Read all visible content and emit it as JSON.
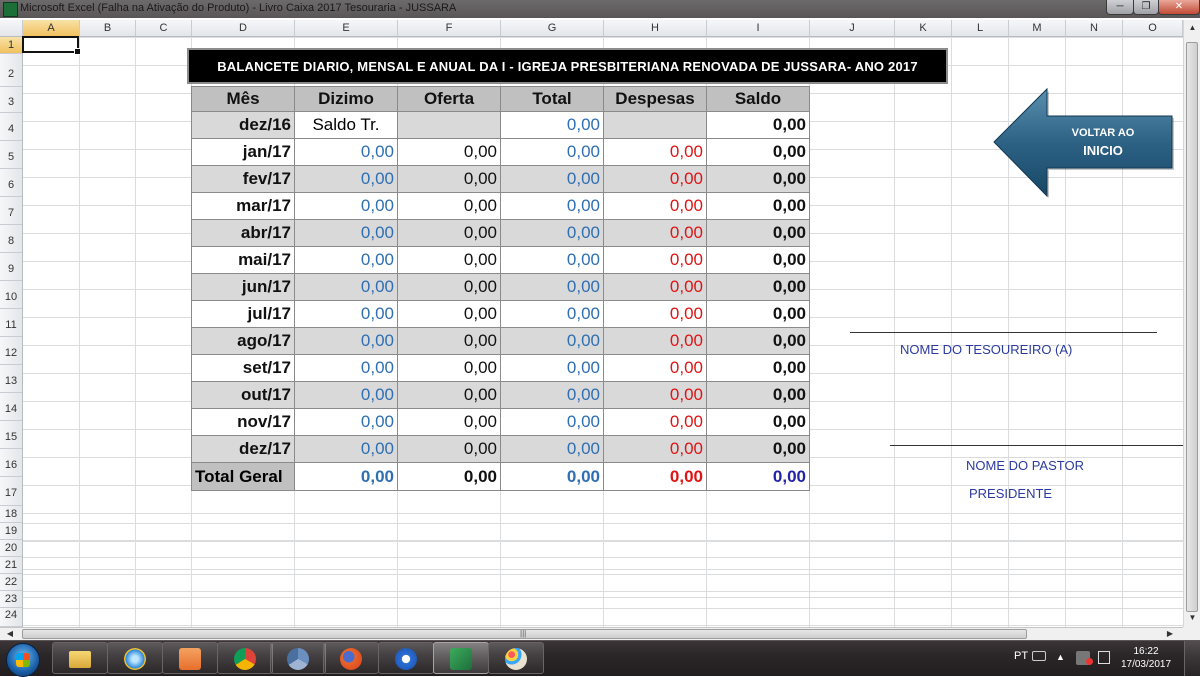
{
  "window": {
    "title": "Microsoft Excel (Falha na Ativação do Produto) - Livro Caixa 2017 Tesouraria - JUSSARA",
    "minimize_glyph": "─",
    "restore_glyph": "❐",
    "close_glyph": "✕"
  },
  "columns": [
    "A",
    "B",
    "C",
    "D",
    "E",
    "F",
    "G",
    "H",
    "I",
    "J",
    "K",
    "L",
    "M",
    "N",
    "O"
  ],
  "rows": [
    "1",
    "2",
    "3",
    "4",
    "5",
    "6",
    "7",
    "8",
    "9",
    "10",
    "11",
    "12",
    "13",
    "14",
    "15",
    "16",
    "17",
    "18",
    "19",
    "20",
    "21",
    "22",
    "23",
    "24"
  ],
  "selected_cell": "A1",
  "banner": "BALANCETE DIARIO, MENSAL E ANUAL DA  I - IGREJA PRESBITERIANA RENOVADA  DE JUSSARA-  ANO 2017",
  "table": {
    "headers": [
      "Mês",
      "Dizimo",
      "Oferta",
      "Total",
      "Despesas",
      "Saldo"
    ],
    "first_row": {
      "month": "dez/16",
      "dizimo": "Saldo Tr.",
      "oferta": "",
      "total": "0,00",
      "despesas": "",
      "saldo": "0,00"
    },
    "rows": [
      {
        "month": "jan/17",
        "dizimo": "0,00",
        "oferta": "0,00",
        "total": "0,00",
        "despesas": "0,00",
        "saldo": "0,00"
      },
      {
        "month": "fev/17",
        "dizimo": "0,00",
        "oferta": "0,00",
        "total": "0,00",
        "despesas": "0,00",
        "saldo": "0,00"
      },
      {
        "month": "mar/17",
        "dizimo": "0,00",
        "oferta": "0,00",
        "total": "0,00",
        "despesas": "0,00",
        "saldo": "0,00"
      },
      {
        "month": "abr/17",
        "dizimo": "0,00",
        "oferta": "0,00",
        "total": "0,00",
        "despesas": "0,00",
        "saldo": "0,00"
      },
      {
        "month": "mai/17",
        "dizimo": "0,00",
        "oferta": "0,00",
        "total": "0,00",
        "despesas": "0,00",
        "saldo": "0,00"
      },
      {
        "month": "jun/17",
        "dizimo": "0,00",
        "oferta": "0,00",
        "total": "0,00",
        "despesas": "0,00",
        "saldo": "0,00"
      },
      {
        "month": "jul/17",
        "dizimo": "0,00",
        "oferta": "0,00",
        "total": "0,00",
        "despesas": "0,00",
        "saldo": "0,00"
      },
      {
        "month": "ago/17",
        "dizimo": "0,00",
        "oferta": "0,00",
        "total": "0,00",
        "despesas": "0,00",
        "saldo": "0,00"
      },
      {
        "month": "set/17",
        "dizimo": "0,00",
        "oferta": "0,00",
        "total": "0,00",
        "despesas": "0,00",
        "saldo": "0,00"
      },
      {
        "month": "out/17",
        "dizimo": "0,00",
        "oferta": "0,00",
        "total": "0,00",
        "despesas": "0,00",
        "saldo": "0,00"
      },
      {
        "month": "nov/17",
        "dizimo": "0,00",
        "oferta": "0,00",
        "total": "0,00",
        "despesas": "0,00",
        "saldo": "0,00"
      },
      {
        "month": "dez/17",
        "dizimo": "0,00",
        "oferta": "0,00",
        "total": "0,00",
        "despesas": "0,00",
        "saldo": "0,00"
      }
    ],
    "total": {
      "label": "Total Geral",
      "dizimo": "0,00",
      "oferta": "0,00",
      "total": "0,00",
      "despesas": "0,00",
      "saldo": "0,00"
    }
  },
  "back_button": {
    "line1": "VOLTAR AO",
    "line2": "INICIO"
  },
  "signatures": {
    "treasurer": "NOME DO TESOUREIRO  (A)",
    "pastor": "NOME DO PASTOR",
    "president": "PRESIDENTE"
  },
  "taskbar": {
    "apps": [
      "explorer-icon",
      "internet-explorer-icon",
      "media-player-icon",
      "chrome-icon",
      "chrome-icon",
      "firefox-icon",
      "shield-icon",
      "excel-icon",
      "paint-icon"
    ],
    "active_app": "excel-icon",
    "language": "PT",
    "time": "16:22",
    "date": "17/03/2017"
  },
  "colors": {
    "blue_value": "#2e6fb3",
    "red_value": "#e01414",
    "header_gray": "#c0c0c0",
    "shade_gray": "#d9d9d9",
    "signature_text": "#2b3a9e"
  }
}
